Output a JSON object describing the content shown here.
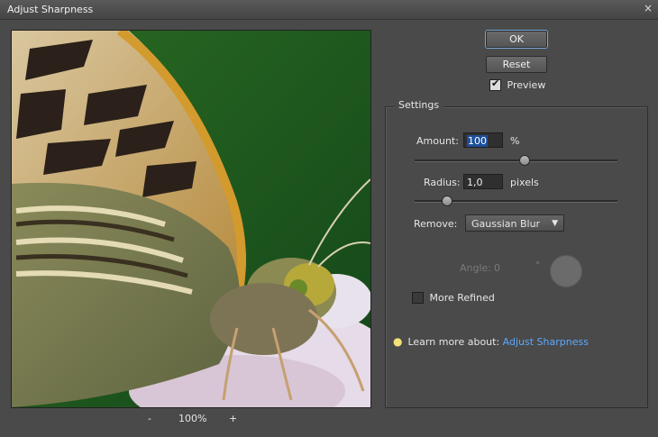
{
  "window": {
    "title": "Adjust Sharpness",
    "close_glyph": "×"
  },
  "preview": {
    "zoom_minus": "-",
    "zoom_level": "100%",
    "zoom_plus": "+"
  },
  "buttons": {
    "ok": "OK",
    "reset": "Reset"
  },
  "preview_checkbox": {
    "label": "Preview",
    "checked": true
  },
  "settings": {
    "legend": "Settings",
    "amount": {
      "label": "Amount:",
      "value": "100",
      "unit": "%",
      "slider_fraction": 0.54
    },
    "radius": {
      "label": "Radius:",
      "value": "1,0",
      "unit": "pixels",
      "slider_fraction": 0.16
    },
    "remove": {
      "label": "Remove:",
      "selected": "Gaussian Blur"
    },
    "angle": {
      "label": "Angle:",
      "value": "0",
      "unit": "°"
    },
    "more_refined": {
      "label": "More Refined",
      "checked": false
    }
  },
  "learn_more": {
    "prefix": "Learn more about:",
    "link": "Adjust Sharpness"
  },
  "icons": {
    "bulb": "lightbulb-icon",
    "dropdown": "chevron-down-icon"
  }
}
